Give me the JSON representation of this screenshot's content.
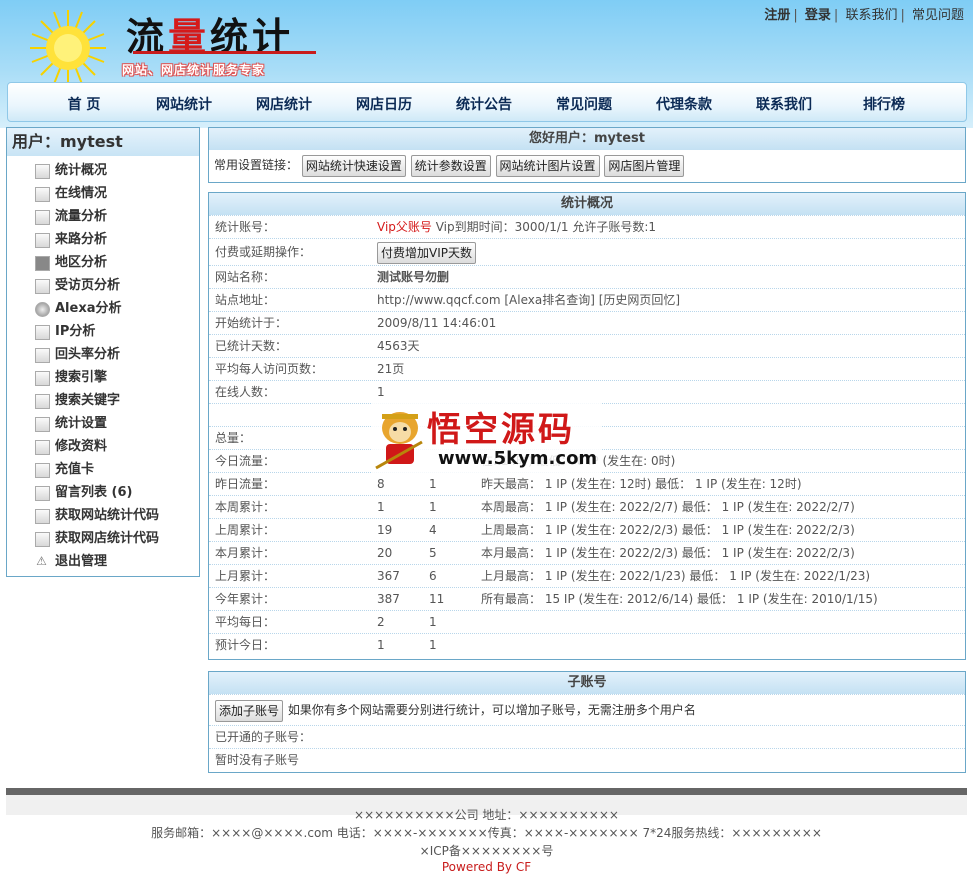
{
  "header": {
    "logo_title_a": "流",
    "logo_title_b": "量",
    "logo_title_c": "统计",
    "logo_subtitle": "网站、网店统计服务专家",
    "top_links": [
      "注册",
      "登录",
      "联系我们",
      "常见问题"
    ]
  },
  "nav": [
    "首 页",
    "网站统计",
    "网店统计",
    "网店日历",
    "统计公告",
    "常见问题",
    "代理条款",
    "联系我们",
    "排行榜"
  ],
  "sidebar": {
    "title": "用户：mytest",
    "items": [
      {
        "label": "统计概况",
        "icon": "page-icon"
      },
      {
        "label": "在线情况",
        "icon": "page-icon"
      },
      {
        "label": "流量分析",
        "icon": "document-icon"
      },
      {
        "label": "来路分析",
        "icon": "document-icon"
      },
      {
        "label": "地区分析",
        "icon": "map-icon"
      },
      {
        "label": "受访页分析",
        "icon": "calendar-icon"
      },
      {
        "label": "Alexa分析",
        "icon": "globe-icon"
      },
      {
        "label": "IP分析",
        "icon": "ip-icon"
      },
      {
        "label": "回头率分析",
        "icon": "page-icon"
      },
      {
        "label": "搜索引擎",
        "icon": "search-icon"
      },
      {
        "label": "搜索关键字",
        "icon": "page-icon"
      },
      {
        "label": "统计设置",
        "icon": "gear-icon"
      },
      {
        "label": "修改资料",
        "icon": "edit-icon"
      },
      {
        "label": "充值卡",
        "icon": "card-icon"
      },
      {
        "label": "留言列表 (6)",
        "icon": "message-icon"
      },
      {
        "label": "获取网站统计代码",
        "icon": "arrow-icon"
      },
      {
        "label": "获取网店统计代码",
        "icon": "arrow-icon"
      },
      {
        "label": "退出管理",
        "icon": "warning-icon"
      }
    ]
  },
  "welcome": {
    "title": "您好用户：mytest",
    "settings_label": "常用设置链接：",
    "buttons": [
      "网站统计快速设置",
      "统计参数设置",
      "网站统计图片设置",
      "网店图片管理"
    ]
  },
  "overview": {
    "title": "统计概况",
    "account_label": "统计账号：",
    "account_vip": "Vip父账号",
    "account_info": " Vip到期时间：3000/1/1 允许子账号数:1",
    "pay_label": "付费或延期操作：",
    "pay_button": "付费增加VIP天数",
    "site_name_label": "网站名称：",
    "site_name": "测试账号勿删",
    "site_url_label": "站点地址：",
    "site_url": "http://www.qqcf.com [Alexa排名查询] [历史网页回忆]",
    "start_label": "开始统计于：",
    "start_value": "2009/8/11 14:46:01",
    "days_label": "已统计天数：",
    "days_value": "4563天",
    "avg_pages_label": "平均每人访问页数：",
    "avg_pages_value": "21页",
    "online_label": "在线人数：",
    "online_value": "1",
    "total_label": "总量：",
    "stats": [
      {
        "label": "今日流量：",
        "a": "",
        "b": "",
        "c": "在: 14时) 最低： 0 IP (发生在: 0时)"
      },
      {
        "label": "昨日流量：",
        "a": "8",
        "b": "1",
        "c": "昨天最高： 1 IP (发生在: 12时) 最低： 1 IP (发生在: 12时)"
      },
      {
        "label": "本周累计：",
        "a": "1",
        "b": "1",
        "c": "本周最高： 1 IP (发生在: 2022/2/7) 最低： 1 IP (发生在: 2022/2/7)"
      },
      {
        "label": "上周累计：",
        "a": "19",
        "b": "4",
        "c": "上周最高： 1 IP (发生在: 2022/2/3) 最低： 1 IP (发生在: 2022/2/3)"
      },
      {
        "label": "本月累计：",
        "a": "20",
        "b": "5",
        "c": "本月最高： 1 IP (发生在: 2022/2/3) 最低： 1 IP (发生在: 2022/2/3)"
      },
      {
        "label": "上月累计：",
        "a": "367",
        "b": "6",
        "c": "上月最高： 1 IP (发生在: 2022/1/23) 最低： 1 IP (发生在: 2022/1/23)"
      },
      {
        "label": "今年累计：",
        "a": "387",
        "b": "11",
        "c": "所有最高： 15 IP (发生在: 2012/6/14) 最低： 1 IP (发生在: 2010/1/15)"
      },
      {
        "label": "平均每日：",
        "a": "2",
        "b": "1",
        "c": ""
      },
      {
        "label": "预计今日：",
        "a": "1",
        "b": "1",
        "c": ""
      }
    ]
  },
  "subaccount": {
    "title": "子账号",
    "add_button": "添加子账号",
    "add_hint": "如果你有多个网站需要分别进行统计，可以增加子账号，无需注册多个用户名",
    "opened_label": "已开通的子账号：",
    "none_label": "暂时没有子账号"
  },
  "watermark": {
    "title": "悟空源码",
    "url": "www.5kym.com"
  },
  "footer": {
    "line1": "××××××××××公司 地址：××××××××××",
    "line2": "服务邮箱：××××@××××.com 电话：××××-×××××××传真：××××-××××××× 7*24服务热线：×××××××××",
    "line3": "×ICP备××××××××号",
    "powered": "Powered By CF"
  }
}
